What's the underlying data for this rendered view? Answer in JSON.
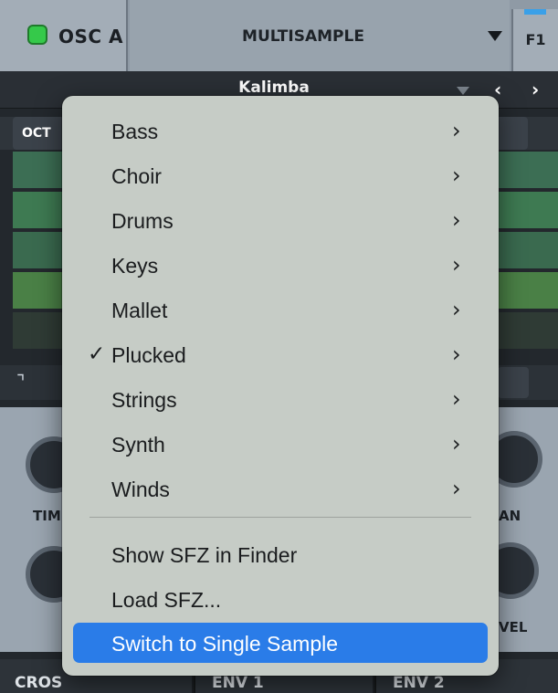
{
  "osc": {
    "label": "OSC A",
    "led_color": "#35c94a",
    "mode": "MULTISAMPLE",
    "filter_tab": "F1"
  },
  "preset": {
    "name": "Kalimba",
    "prev_icon": "chevron-left-icon",
    "next_icon": "chevron-right-icon"
  },
  "controls": {
    "oct_label": "OCT"
  },
  "knobs": [
    {
      "label_fragment": "TIM"
    },
    {
      "label_fragment": "AN"
    },
    {
      "label_fragment": "VEL"
    }
  ],
  "bottom_tabs": [
    "CROS",
    "ENV 1",
    "ENV 2"
  ],
  "menu": {
    "categories": [
      {
        "label": "Bass",
        "checked": false
      },
      {
        "label": "Choir",
        "checked": false
      },
      {
        "label": "Drums",
        "checked": false
      },
      {
        "label": "Keys",
        "checked": false
      },
      {
        "label": "Mallet",
        "checked": false
      },
      {
        "label": "Plucked",
        "checked": true
      },
      {
        "label": "Strings",
        "checked": false
      },
      {
        "label": "Synth",
        "checked": false
      },
      {
        "label": "Winds",
        "checked": false
      }
    ],
    "submenu_glyph": "›",
    "check_glyph": "✓",
    "actions": [
      {
        "label": "Show SFZ in Finder",
        "highlighted": false
      },
      {
        "label": "Load SFZ...",
        "highlighted": false
      },
      {
        "label": "Switch to Single Sample",
        "highlighted": true
      }
    ],
    "highlight_color": "#2a7ce8"
  }
}
